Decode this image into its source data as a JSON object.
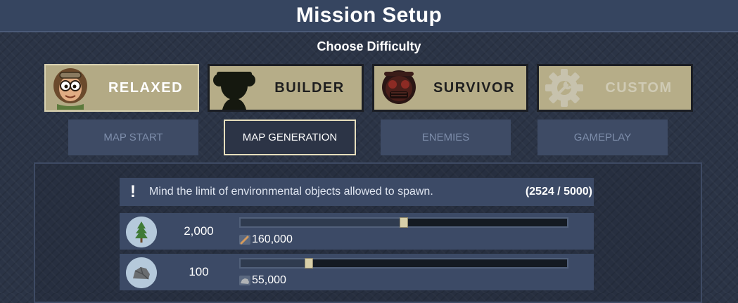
{
  "header": {
    "title": "Mission Setup"
  },
  "difficulty": {
    "heading": "Choose Difficulty",
    "options": [
      {
        "label": "RELAXED",
        "icon": "relaxed-face-icon",
        "state": "selected"
      },
      {
        "label": "BUILDER",
        "icon": "builder-silhouette-icon",
        "state": "normal"
      },
      {
        "label": "SURVIVOR",
        "icon": "survivor-mask-icon",
        "state": "normal"
      },
      {
        "label": "CUSTOM",
        "icon": "gear-wrench-icon",
        "state": "disabled"
      }
    ]
  },
  "tabs": [
    {
      "label": "MAP START",
      "active": false
    },
    {
      "label": "MAP GENERATION",
      "active": true
    },
    {
      "label": "ENEMIES",
      "active": false
    },
    {
      "label": "GAMEPLAY",
      "active": false
    }
  ],
  "warning": {
    "icon": "exclamation-icon",
    "message": "Mind the limit of environmental objects allowed to spawn.",
    "count": "(2524 / 5000)"
  },
  "resources": [
    {
      "icon": "tree-icon",
      "amount": "2,000",
      "slider_fraction": 0.5,
      "yield_icon": "wood-log-icon",
      "yield": "160,000"
    },
    {
      "icon": "rock-icon",
      "amount": "100",
      "slider_fraction": 0.21,
      "yield_icon": "stone-icon",
      "yield": "55,000"
    }
  ],
  "colors": {
    "accent": "#e7dfbd",
    "difficulty_card": "#b6ad88",
    "panel": "#3c4a66",
    "tab_inactive": "#3e4b65"
  }
}
